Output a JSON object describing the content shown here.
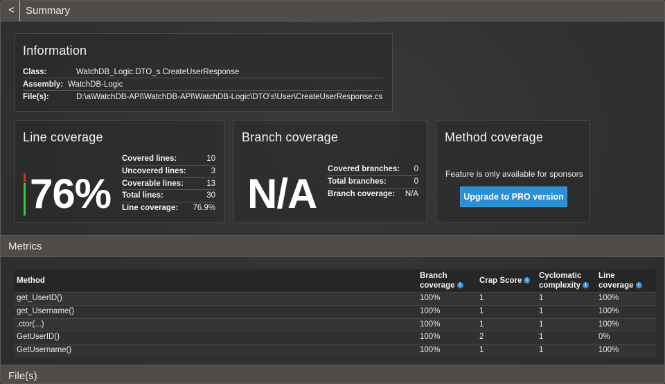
{
  "topbar": {
    "back_label": "<",
    "title": "Summary"
  },
  "information": {
    "title": "Information",
    "class_label": "Class:",
    "class_value": "WatchDB_Logic.DTO_s.CreateUserResponse",
    "assembly_label": "Assembly:",
    "assembly_value": "WatchDB-Logic",
    "files_label": "File(s):",
    "files_value": "D:\\a\\WatchDB-API\\WatchDB-API\\WatchDB-Logic\\DTO's\\User\\CreateUserResponse.cs"
  },
  "line_coverage": {
    "title": "Line coverage",
    "percent": "76%",
    "covered_fraction": 0.769,
    "stats": [
      {
        "label": "Covered lines:",
        "value": "10"
      },
      {
        "label": "Uncovered lines:",
        "value": "3"
      },
      {
        "label": "Coverable lines:",
        "value": "13"
      },
      {
        "label": "Total lines:",
        "value": "30"
      },
      {
        "label": "Line coverage:",
        "value": "76.9%"
      }
    ]
  },
  "branch_coverage": {
    "title": "Branch coverage",
    "big_value": "N/A",
    "stats": [
      {
        "label": "Covered branches:",
        "value": "0"
      },
      {
        "label": "Total branches:",
        "value": "0"
      },
      {
        "label": "Branch coverage:",
        "value": "N/A"
      }
    ]
  },
  "method_coverage": {
    "title": "Method coverage",
    "note": "Feature is only available for sponsors",
    "button_label": "Upgrade to PRO version"
  },
  "metrics": {
    "title": "Metrics",
    "headers": {
      "method": "Method",
      "branch_1": "Branch",
      "branch_2": "coverage",
      "crap": "Crap Score",
      "cyclo_1": "Cyclomatic",
      "cyclo_2": "complexity",
      "line_1": "Line",
      "line_2": "coverage"
    },
    "info_glyph": "i",
    "rows": [
      {
        "method": "get_UserID()",
        "branch": "100%",
        "crap": "1",
        "cyclo": "1",
        "line": "100%"
      },
      {
        "method": "get_Username()",
        "branch": "100%",
        "crap": "1",
        "cyclo": "1",
        "line": "100%"
      },
      {
        "method": ".ctor(...)",
        "branch": "100%",
        "crap": "1",
        "cyclo": "1",
        "line": "100%"
      },
      {
        "method": "GetUserID()",
        "branch": "100%",
        "crap": "2",
        "cyclo": "1",
        "line": "0%"
      },
      {
        "method": "GetUsername()",
        "branch": "100%",
        "crap": "1",
        "cyclo": "1",
        "line": "100%"
      }
    ]
  },
  "files_section": {
    "title": "File(s)"
  },
  "colors": {
    "accent": "#2d8fd5",
    "covered": "#2ecc40",
    "uncovered": "#c0392b",
    "bar_bg": "#4f4c4a"
  }
}
